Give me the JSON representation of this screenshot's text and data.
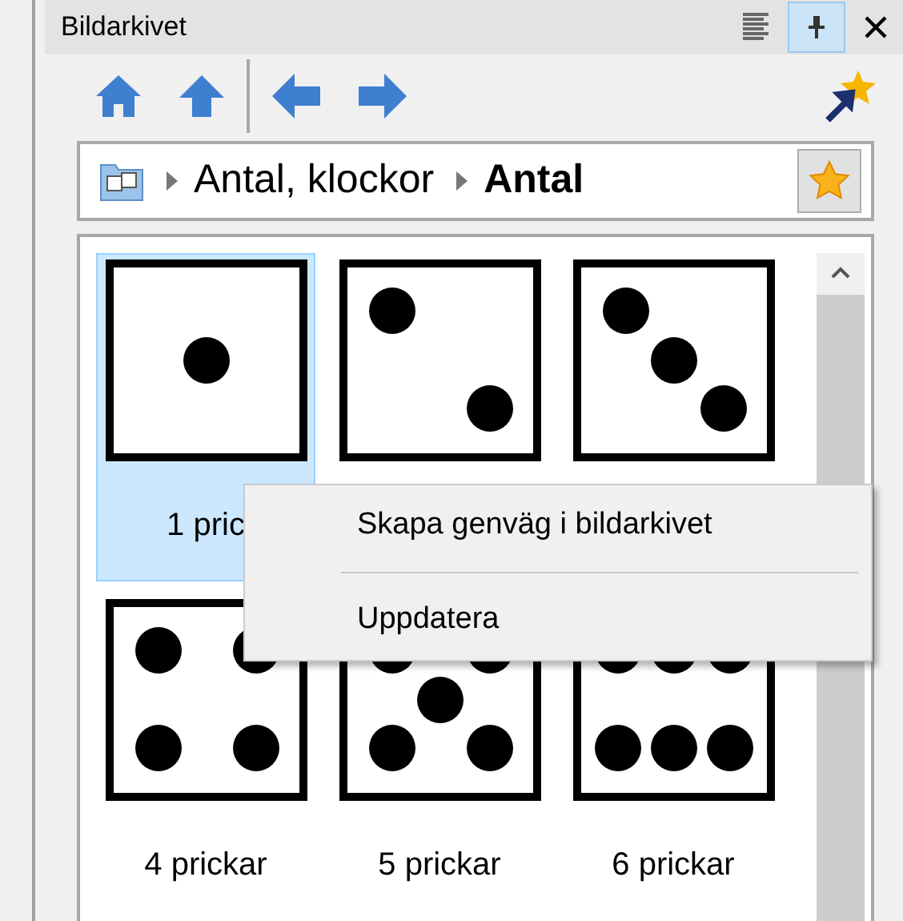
{
  "panel": {
    "title": "Bildarkivet",
    "pinned": true
  },
  "breadcrumb": [
    {
      "label": "Antal, klockor",
      "current": false
    },
    {
      "label": "Antal",
      "current": true
    }
  ],
  "items": [
    {
      "kind": "one",
      "label": "1 pric",
      "selected": true
    },
    {
      "kind": "two",
      "selected": false
    },
    {
      "kind": "three",
      "selected": false
    },
    {
      "kind": "four",
      "label": "4 prickar",
      "selected": false
    },
    {
      "kind": "five",
      "label": "5 prickar",
      "selected": false
    },
    {
      "kind": "six",
      "label": "6 prickar",
      "selected": false
    }
  ],
  "context_menu": {
    "items": [
      "Skapa genväg i bildarkivet",
      "Uppdatera"
    ]
  }
}
